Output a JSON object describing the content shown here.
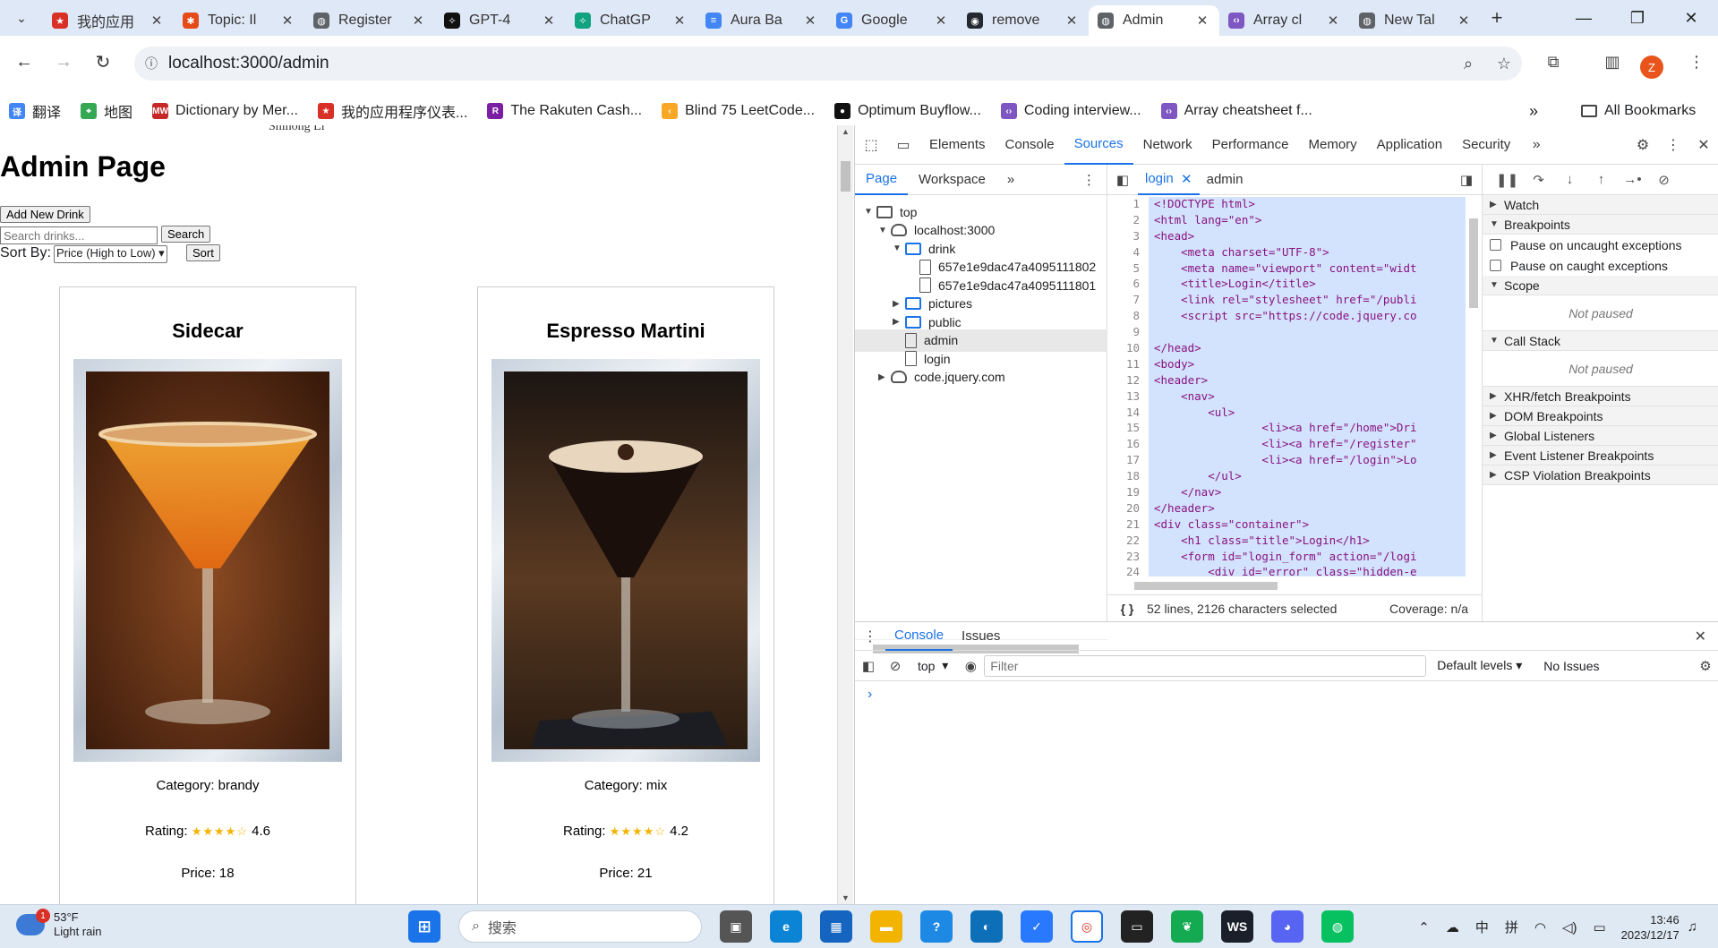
{
  "browser": {
    "tabs": [
      {
        "title": "我的应用",
        "color": "#d93025",
        "glyph": "★"
      },
      {
        "title": "Topic: Il",
        "color": "#e64a19",
        "glyph": "✱"
      },
      {
        "title": "Register",
        "color": "#5f6368",
        "glyph": "◍"
      },
      {
        "title": "GPT-4",
        "color": "#111111",
        "glyph": "✧"
      },
      {
        "title": "ChatGP",
        "color": "#10a37f",
        "glyph": "✧"
      },
      {
        "title": "Aura Ba",
        "color": "#4285f4",
        "glyph": "≡"
      },
      {
        "title": "Google",
        "color": "#4285f4",
        "glyph": "G"
      },
      {
        "title": "remove",
        "color": "#24292f",
        "glyph": "◉"
      },
      {
        "title": "Admin",
        "color": "#5f6368",
        "glyph": "◍",
        "active": true
      },
      {
        "title": "Array cl",
        "color": "#7e57c2",
        "glyph": "‹›"
      },
      {
        "title": "New Tal",
        "color": "#5f6368",
        "glyph": "◍"
      }
    ],
    "url": "localhost:3000/admin",
    "profile_initial": "Z",
    "bookmarks": [
      {
        "label": "翻译",
        "color": "#4285f4",
        "glyph": "译"
      },
      {
        "label": "地图",
        "color": "#34a853",
        "glyph": "⌖"
      },
      {
        "label": "Dictionary by Mer...",
        "color": "#c62828",
        "glyph": "MW"
      },
      {
        "label": "我的应用程序仪表...",
        "color": "#d93025",
        "glyph": "★"
      },
      {
        "label": "The Rakuten Cash...",
        "color": "#7b1fa2",
        "glyph": "R"
      },
      {
        "label": "Blind 75 LeetCode...",
        "color": "#f9a825",
        "glyph": "‹"
      },
      {
        "label": "Optimum Buyflow...",
        "color": "#111111",
        "glyph": "●"
      },
      {
        "label": "Coding interview...",
        "color": "#7e57c2",
        "glyph": "‹›"
      },
      {
        "label": "Array cheatsheet f...",
        "color": "#7e57c2",
        "glyph": "‹›"
      }
    ],
    "all_bookmarks": "All Bookmarks"
  },
  "page": {
    "cut_text": "Shihong Li",
    "title": "Admin Page",
    "add_button": "Add New Drink",
    "search_placeholder": "Search drinks...",
    "search_button": "Search",
    "sort_label": "Sort By:",
    "sort_selected": "Price (High to Low)",
    "sort_button": "Sort",
    "drinks": [
      {
        "name": "Sidecar",
        "category": "Category: brandy",
        "rating_label": "Rating:",
        "stars": "★★★★☆",
        "rating": "4.6",
        "price": "Price: 18"
      },
      {
        "name": "Espresso Martini",
        "category": "Category: mix",
        "rating_label": "Rating:",
        "stars": "★★★★☆",
        "rating": "4.2",
        "price": "Price: 21"
      }
    ]
  },
  "devtools": {
    "tabs": [
      "Elements",
      "Console",
      "Sources",
      "Network",
      "Performance",
      "Memory",
      "Application",
      "Security"
    ],
    "active_tab": "Sources",
    "nav_tabs": [
      "Page",
      "Workspace"
    ],
    "tree": [
      {
        "label": "top",
        "depth": 0,
        "icon": "frame",
        "tri": "▼"
      },
      {
        "label": "localhost:3000",
        "depth": 1,
        "icon": "cloud",
        "tri": "▼"
      },
      {
        "label": "drink",
        "depth": 2,
        "icon": "folder",
        "tri": "▼"
      },
      {
        "label": "657e1e9dac47a4095111802",
        "depth": 3,
        "icon": "file",
        "tri": ""
      },
      {
        "label": "657e1e9dac47a4095111801",
        "depth": 3,
        "icon": "file",
        "tri": ""
      },
      {
        "label": "pictures",
        "depth": 2,
        "icon": "folder",
        "tri": "▶"
      },
      {
        "label": "public",
        "depth": 2,
        "icon": "folder",
        "tri": "▶"
      },
      {
        "label": "admin",
        "depth": 2,
        "icon": "file",
        "tri": "",
        "selected": true
      },
      {
        "label": "login",
        "depth": 2,
        "icon": "file",
        "tri": ""
      },
      {
        "label": "code.jquery.com",
        "depth": 1,
        "icon": "cloud",
        "tri": "▶"
      }
    ],
    "editor_tabs": [
      "login",
      "admin"
    ],
    "code_lines": [
      "<!DOCTYPE html>",
      "<html lang=\"en\">",
      "<head>",
      "    <meta charset=\"UTF-8\">",
      "    <meta name=\"viewport\" content=\"widt",
      "    <title>Login</title>",
      "    <link rel=\"stylesheet\" href=\"/publi",
      "    <script src=\"https://code.jquery.co",
      "",
      "</head>",
      "<body>",
      "<header>",
      "    <nav>",
      "        <ul>",
      "                <li><a href=\"/home\">Dri",
      "                <li><a href=\"/register\"",
      "                <li><a href=\"/login\">Lo",
      "        </ul>",
      "    </nav>",
      "</header>",
      "<div class=\"container\">",
      "    <h1 class=\"title\">Login</h1>",
      "    <form id=\"login_form\" action=\"/logi",
      "        <div id=\"error\" class=\"hidden-e"
    ],
    "status_selected": "52 lines, 2126 characters selected",
    "status_coverage": "Coverage: n/a",
    "debug": {
      "watch": "Watch",
      "breakpoints": "Breakpoints",
      "pause_uncaught": "Pause on uncaught exceptions",
      "pause_caught": "Pause on caught exceptions",
      "scope": "Scope",
      "not_paused": "Not paused",
      "call_stack": "Call Stack",
      "not_paused_2": "Not paused",
      "more": [
        "XHR/fetch Breakpoints",
        "DOM Breakpoints",
        "Global Listeners",
        "Event Listener Breakpoints",
        "CSP Violation Breakpoints"
      ]
    },
    "drawer_tabs": [
      "Console",
      "Issues"
    ],
    "context": "top",
    "filter_placeholder": "Filter",
    "levels": "Default levels ▾",
    "issues": "No Issues",
    "prompt": "›"
  },
  "taskbar": {
    "temp": "53°F",
    "weather": "Light rain",
    "badge": "1",
    "search_placeholder": "搜索",
    "ime1": "中",
    "ime2": "拼",
    "time": "13:46",
    "date": "2023/12/17"
  }
}
